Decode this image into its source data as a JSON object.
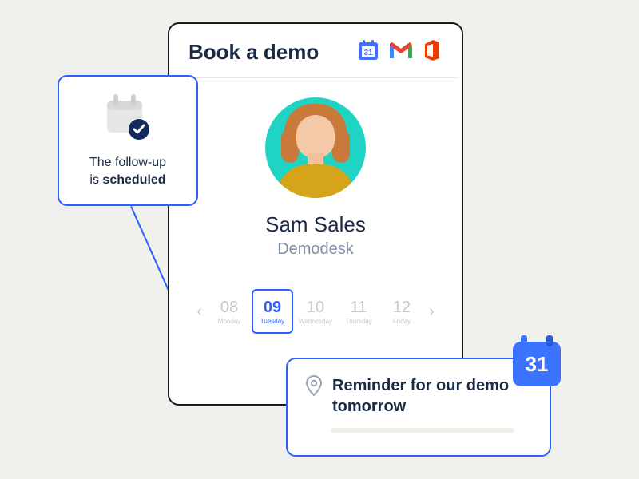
{
  "header": {
    "title": "Book a demo",
    "calendar_badge": "31"
  },
  "profile": {
    "name": "Sam Sales",
    "company": "Demodesk"
  },
  "dates": [
    {
      "day": "08",
      "label": "Monday"
    },
    {
      "day": "09",
      "label": "Tuesday"
    },
    {
      "day": "10",
      "label": "Wednesday"
    },
    {
      "day": "11",
      "label": "Thursday"
    },
    {
      "day": "12",
      "label": "Friday"
    }
  ],
  "selected_date_index": 1,
  "followup": {
    "line1": "The follow-up",
    "line2_prefix": "is ",
    "line2_bold": "scheduled"
  },
  "reminder": {
    "text": "Reminder for our demo tomorrow",
    "calendar_badge": "31"
  }
}
